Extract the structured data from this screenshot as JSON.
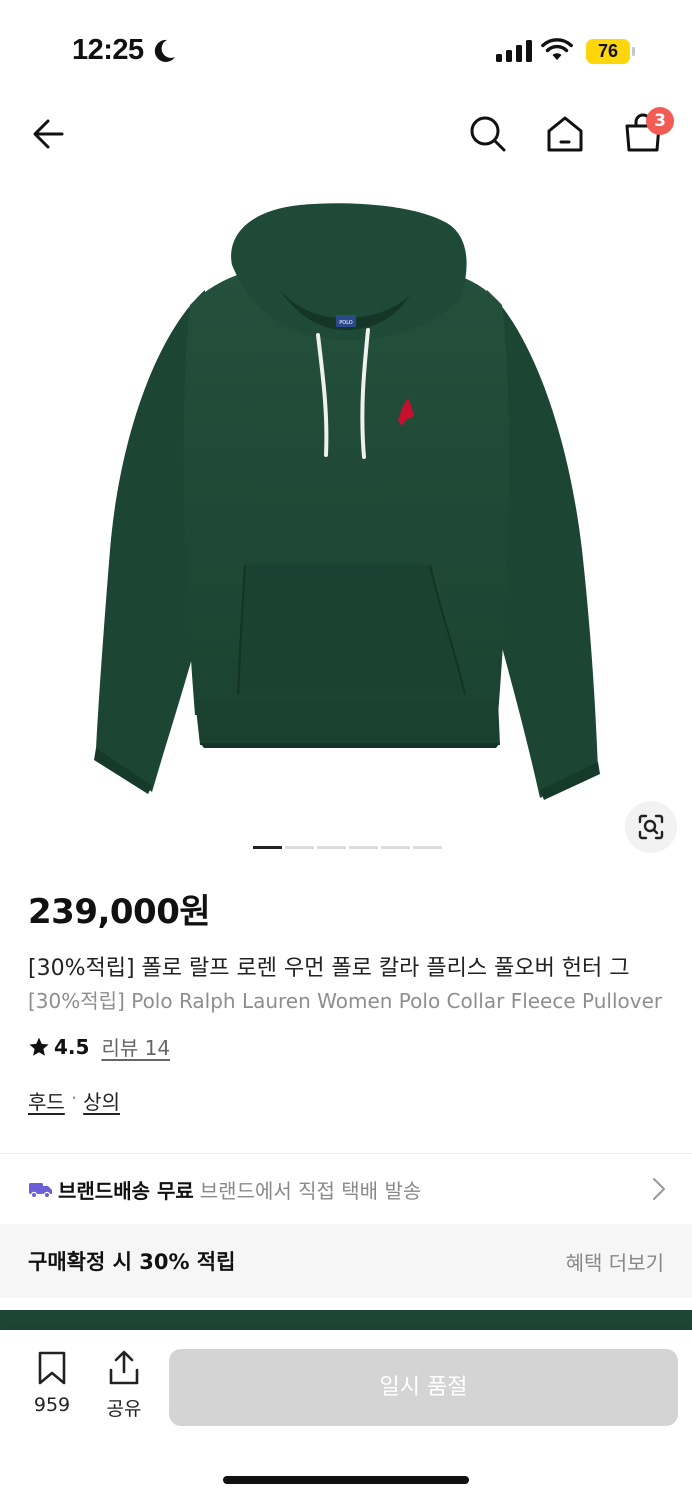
{
  "status_bar": {
    "time": "12:25",
    "battery": "76"
  },
  "nav": {
    "cart_count": "3"
  },
  "gallery": {
    "image_count": 6,
    "active_index": 0,
    "logo_text": "POLO"
  },
  "product": {
    "price": "239,000원",
    "title_ko": "[30%적립] 폴로 랄프 로렌 우먼 폴로 칼라 플리스 풀오버 헌터 그",
    "title_en": "[30%적립] Polo Ralph Lauren Women Polo Collar Fleece Pullover",
    "rating": "4.5",
    "review_label": "리뷰 14",
    "categories": [
      "후드",
      "상의"
    ],
    "category_separator": "·"
  },
  "shipping": {
    "label": "브랜드배송 무료",
    "detail": "브랜드에서 직접 택배 발송"
  },
  "benefit": {
    "title": "구매확정 시 30% 적립",
    "more_label": "혜택 더보기"
  },
  "bottom_bar": {
    "like_count": "959",
    "share_label": "공유",
    "purchase_label": "일시 품절"
  },
  "colors": {
    "hoodie_green": "#1e4634",
    "badge_red": "#f25c54",
    "battery_yellow": "#ffd60a",
    "truck_purple": "#6b5fd6",
    "disabled_button": "#d4d4d4"
  }
}
